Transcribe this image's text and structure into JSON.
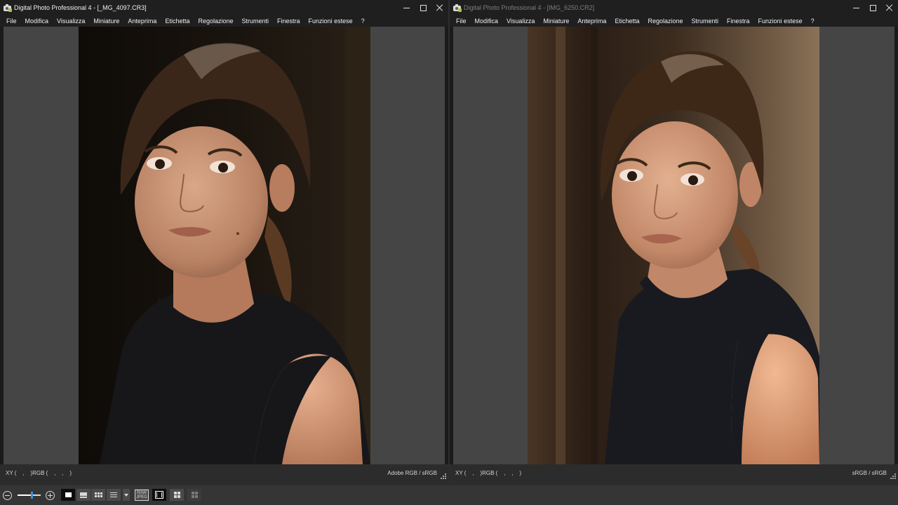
{
  "windows": [
    {
      "title": "Digital Photo Professional 4 - [_MG_4097.CR3]",
      "active": true,
      "status_xy": "XY (    ,    )RGB (    ,    ,    )",
      "color_space": "Adobe RGB / sRGB"
    },
    {
      "title": "Digital Photo Professional 4 - [IMG_6250.CR2]",
      "active": false,
      "status_xy": "XY (    ,    )RGB (    ,    ,    )",
      "color_space": "sRGB / sRGB"
    }
  ],
  "menu": [
    "File",
    "Modifica",
    "Visualizza",
    "Miniature",
    "Anteprima",
    "Etichetta",
    "Regolazione",
    "Strumenti",
    "Finestra",
    "Funzioni estese",
    "?"
  ],
  "window_controls": {
    "minimize_icon": "minimize-icon",
    "maximize_icon": "maximize-icon",
    "close_icon": "close-icon"
  },
  "toolbar": {
    "zoom_level": 0.6,
    "raw_label_top": "RAW",
    "raw_label_bottom": "JPEG",
    "buttons": [
      "zoom-out-icon",
      "zoom-slider",
      "zoom-in-icon",
      "single-view-icon",
      "split-view-icon",
      "grid-view-icon",
      "list-view-icon",
      "dropdown-icon",
      "raw-jpeg-icon",
      "filmstrip-icon",
      "four-grid-icon",
      "compare-grid-icon"
    ]
  },
  "colors": {
    "window_bg": "#1a1a1a",
    "canvas_bg": "#454545",
    "accent": "#3a8ee6"
  }
}
